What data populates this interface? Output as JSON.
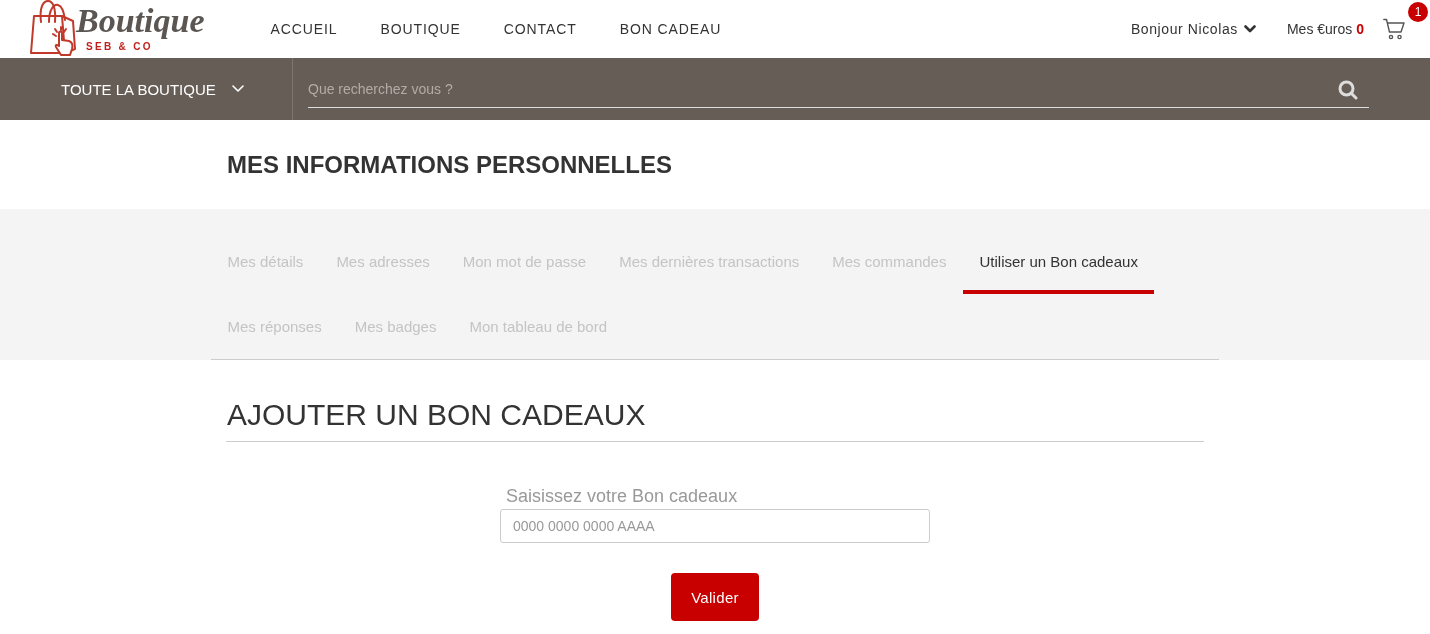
{
  "header": {
    "logo": {
      "wordmark": "Boutique",
      "tagline": "SEB & CO"
    },
    "nav": [
      {
        "label": "ACCUEIL"
      },
      {
        "label": "BOUTIQUE"
      },
      {
        "label": "CONTACT"
      },
      {
        "label": "BON CADEAU"
      }
    ],
    "greeting": "Bonjour Nicolas",
    "euros": "Mes €uros **0**",
    "cart": {
      "count": "1"
    }
  },
  "toolbar": {
    "category_menu": "TOUTE LA BOUTIQUE",
    "search": {
      "placeholder": "Que recherchez vous ?"
    }
  },
  "page": {
    "title": "MES INFORMATIONS PERSONNELLES"
  },
  "tabs": [
    {
      "label": "Mes détails",
      "selected": false
    },
    {
      "label": "Mes adresses",
      "selected": false
    },
    {
      "label": "Mon mot de passe",
      "selected": false
    },
    {
      "label": "Mes dernières transactions",
      "selected": false
    },
    {
      "label": "Mes commandes",
      "selected": false
    },
    {
      "label": "Utiliser un Bon cadeaux",
      "selected": true
    },
    {
      "label": "Mes réponses",
      "selected": false
    },
    {
      "label": "Mes badges",
      "selected": false
    },
    {
      "label": "Mon tableau de bord",
      "selected": false
    }
  ],
  "voucher_form": {
    "heading": "AJOUTER UN BON CADEAUX",
    "label": "Saisissez votre Bon cadeaux",
    "placeholder": "0000 0000 0000 AAAA",
    "submit": "Valider"
  }
}
